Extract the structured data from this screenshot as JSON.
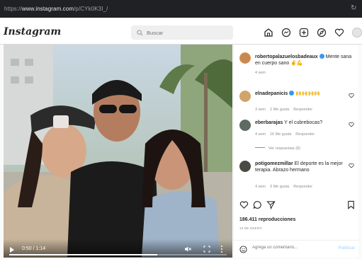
{
  "browser": {
    "url_prefix": "https://",
    "url_host": "www.instagram.com",
    "url_path": "/p/CYk0K3I_/"
  },
  "nav": {
    "logo": "Instagram",
    "search_placeholder": "Buscar",
    "icons": [
      "home-icon",
      "messenger-icon",
      "new-post-icon",
      "explore-icon",
      "activity-heart-icon",
      "profile-avatar"
    ]
  },
  "video": {
    "time": "0:50 / 1:14",
    "progress_fraction": 0.68
  },
  "post": {
    "author": "robertopalazuelosbadeaux",
    "caption": "Mente sana en cuerpo sano ✌️💪",
    "age": "4 sem"
  },
  "comments": [
    {
      "user": "elnadepanicis",
      "verified": true,
      "text": "🙌🙌🙌🙌",
      "age": "3 sem",
      "likes": "2 Me gusta",
      "reply": "Responder"
    },
    {
      "user": "eberbarajas",
      "verified": false,
      "text": "Y el cubrebocas?",
      "age": "4 sem",
      "likes": "16 Me gusta",
      "reply": "Responder",
      "view_replies": "Ver respuestas (8)"
    },
    {
      "user": "potigomezmillar",
      "verified": false,
      "text": "El deporte es la mejor terapia. Abrazo hermano",
      "age": "4 sem",
      "likes": "3 Me gusta",
      "reply": "Responder"
    }
  ],
  "stats": {
    "views": "186.411 reproducciones",
    "date": "16 DE ENERO"
  },
  "add_comment": {
    "placeholder": "Agrega un comentario...",
    "publish": "Publicar"
  },
  "colors": {
    "verified": "#3897f0",
    "link_blue": "#0095f6",
    "muted": "#8e8e8e"
  }
}
